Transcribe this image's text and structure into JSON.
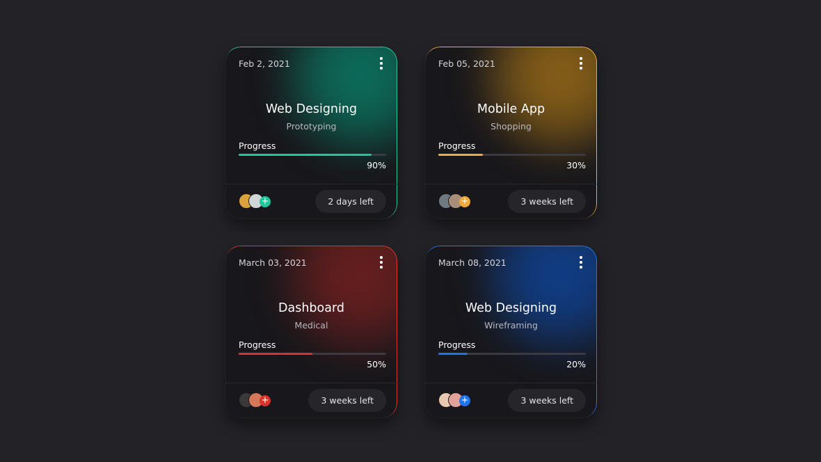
{
  "cards": [
    {
      "date": "Feb 2, 2021",
      "title": "Web Designing",
      "subtitle": "Prototyping",
      "progress_label": "Progress",
      "progress": 0.9,
      "progress_text": "90%",
      "time_left": "2 days left",
      "accent": "#1fc79a",
      "glow": "#0c6f5d",
      "avatars": [
        "#d9a23b",
        "#cfd6d8"
      ],
      "add_label": "+"
    },
    {
      "date": "Feb 05, 2021",
      "title": "Mobile App",
      "subtitle": "Shopping",
      "progress_label": "Progress",
      "progress": 0.3,
      "progress_text": "30%",
      "time_left": "3 weeks left",
      "accent": "#f2a93b",
      "glow": "#8a6118",
      "avatars": [
        "#6f7a80",
        "#a88e78"
      ],
      "add_label": "+"
    },
    {
      "date": "March 03, 2021",
      "title": "Dashboard",
      "subtitle": "Medical",
      "progress_label": "Progress",
      "progress": 0.5,
      "progress_text": "50%",
      "time_left": "3 weeks left",
      "accent": "#d8322c",
      "glow": "#6a1f1f",
      "avatars": [
        "#3a3838",
        "#d5785a"
      ],
      "add_label": "+"
    },
    {
      "date": "March 08, 2021",
      "title": "Web Designing",
      "subtitle": "Wireframing",
      "progress_label": "Progress",
      "progress": 0.2,
      "progress_text": "20%",
      "time_left": "3 weeks left",
      "accent": "#1f73f0",
      "glow": "#103f8a",
      "avatars": [
        "#e9c8b0",
        "#e2a199"
      ],
      "add_label": "+"
    }
  ]
}
